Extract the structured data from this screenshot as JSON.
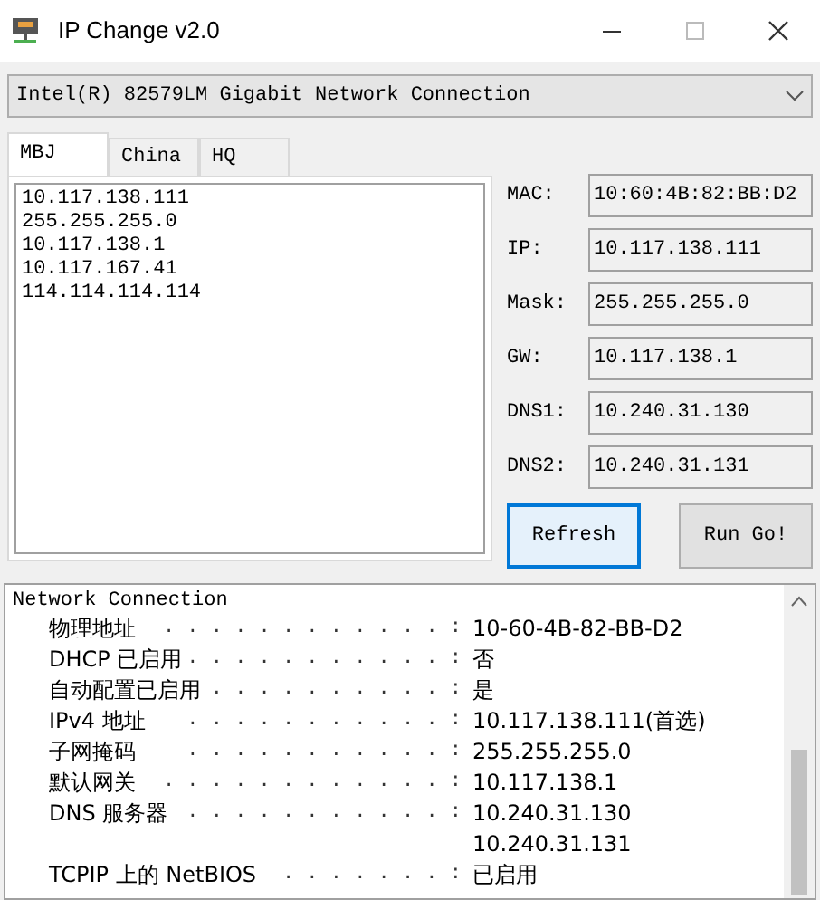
{
  "window": {
    "title": "IP Change v2.0"
  },
  "adapter": {
    "value": "Intel(R) 82579LM Gigabit Network Connection"
  },
  "tabs": [
    {
      "label": "MBJ",
      "selected": true
    },
    {
      "label": "China",
      "selected": false
    },
    {
      "label": "HQ",
      "selected": false
    }
  ],
  "profile_text": [
    "10.117.138.111",
    "255.255.255.0",
    "10.117.138.1",
    "10.117.167.41",
    "114.114.114.114"
  ],
  "fields": [
    {
      "label": "MAC:",
      "value": "10:60:4B:82:BB:D2"
    },
    {
      "label": "IP:",
      "value": "10.117.138.111"
    },
    {
      "label": "Mask:",
      "value": "255.255.255.0"
    },
    {
      "label": "GW:",
      "value": "10.117.138.1"
    },
    {
      "label": "DNS1:",
      "value": "10.240.31.130"
    },
    {
      "label": "DNS2:",
      "value": "10.240.31.131"
    }
  ],
  "buttons": [
    {
      "label": "Refresh",
      "focused": true
    },
    {
      "label": "Run Go!",
      "focused": false
    }
  ],
  "output": {
    "title": "Network Connection",
    "rows": [
      {
        "label": "物理地址",
        "leader": ". . . . . . . . . . . . :",
        "values": [
          "10-60-4B-82-BB-D2"
        ]
      },
      {
        "label": "DHCP 已启用",
        "leader": ". . . . . . . . . . . :",
        "values": [
          "否"
        ]
      },
      {
        "label": "自动配置已启用",
        "leader": ". . . . . . . . . . :",
        "values": [
          "是"
        ]
      },
      {
        "label": "IPv4 地址",
        "leader": ". . . . . . . . . . . :",
        "values": [
          "10.117.138.111(首选)"
        ]
      },
      {
        "label": "子网掩码",
        "leader": ". . . . . . . . . . . :",
        "values": [
          "255.255.255.0"
        ]
      },
      {
        "label": "默认网关",
        "leader": ". . . . . . . . . . . . :",
        "values": [
          "10.117.138.1"
        ]
      },
      {
        "label": "DNS 服务器",
        "leader": ". . . . . . . . . . . :",
        "values": [
          "10.240.31.130",
          "10.240.31.131"
        ]
      },
      {
        "label": "TCPIP 上的 NetBIOS",
        "leader": ". . . . . . . :",
        "values": [
          "已启用"
        ]
      }
    ]
  }
}
